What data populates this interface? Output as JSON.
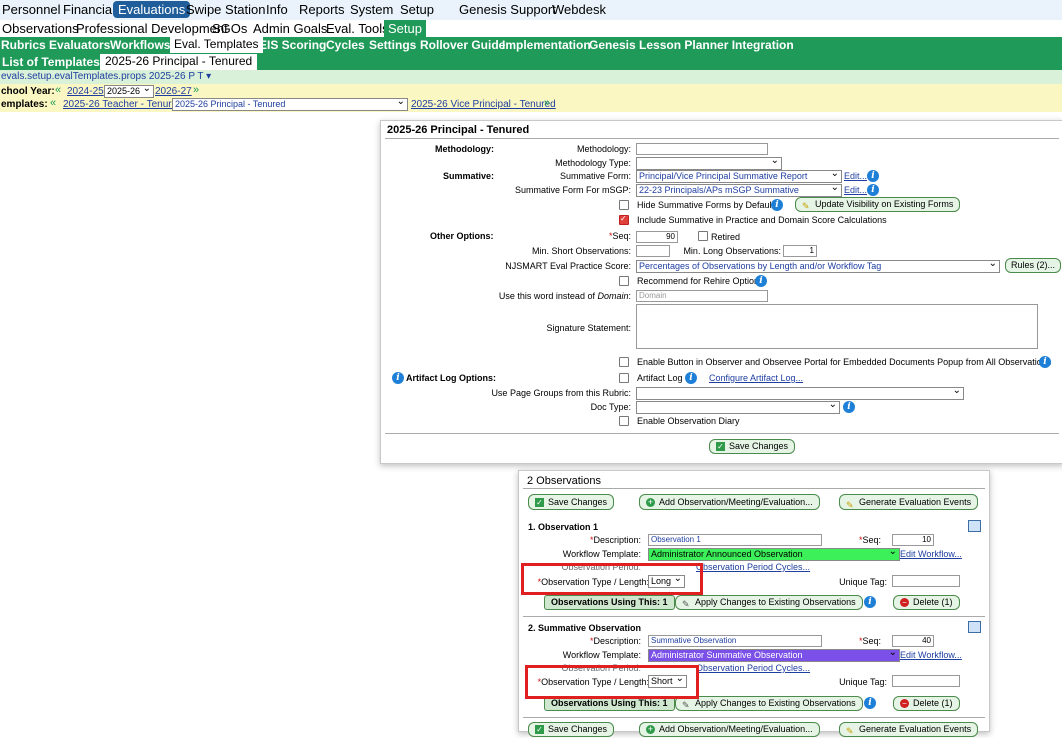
{
  "nav": {
    "main": [
      "Personnel",
      "Financial",
      "Evaluations",
      "Swipe Station",
      "Info",
      "Reports",
      "System",
      "Setup",
      "Genesis Support",
      "Webdesk"
    ],
    "sub": [
      "Observations",
      "Professional Development",
      "SGOs",
      "Admin Goals",
      "Eval. Tools",
      "Setup"
    ],
    "setup": [
      "Rubrics",
      "Evaluators",
      "Workflows",
      "Eval. Templates",
      "EIS Scoring",
      "Cycles",
      "Settings",
      "Rollover Guide",
      "Implementation",
      "Genesis Lesson Planner Integration"
    ],
    "list_label": "List of Templates",
    "current_template": "2025-26 Principal - Tenured"
  },
  "path": "evals.setup.evalTemplates.props 2025-26 P T",
  "year": {
    "label": "chool Year:",
    "prev": "2024-25",
    "current": "2025-26",
    "next": "2026-27",
    "templates_label": "emplates:",
    "prev_tpl": "2025-26 Teacher - Tenured",
    "current_tpl": "2025-26 Principal - Tenured",
    "next_tpl": "2025-26 Vice Principal - Tenured"
  },
  "template": {
    "title": "2025-26 Principal - Tenured",
    "methodology_section": "Methodology:",
    "methodology_label": "Methodology:",
    "methodology_type_label": "Methodology Type:",
    "summative_section": "Summative:",
    "summative_form_label": "Summative Form:",
    "summative_form_value": "Principal/Vice Principal Summative Report",
    "edit_link": "Edit...",
    "summative_msgp_label": "Summative Form For mSGP:",
    "summative_msgp_value": "22-23 Principals/APs mSGP Summative",
    "hide_summative": "Hide Summative Forms by Default",
    "update_visibility": "Update Visibility on Existing Forms",
    "include_summative": "Include Summative in Practice and Domain Score Calculations",
    "other_section": "Other Options:",
    "seq_label": "Seq:",
    "seq_value": "90",
    "retired": "Retired",
    "min_short_label": "Min. Short Observations:",
    "min_long_label": "Min. Long Observations:",
    "min_long_value": "1",
    "njsmart_label": "NJSMART Eval Practice Score:",
    "njsmart_value": "Percentages of Observations by Length and/or Workflow Tag",
    "rules_btn": "Rules (2)...",
    "rehire": "Recommend for Rehire Option",
    "use_word_label": "Use this word instead of",
    "use_word_em": "Domain",
    "use_word_placeholder": "Domain",
    "signature_label": "Signature Statement:",
    "enable_button": "Enable Button in Observer and Observee Portal for Embedded Documents Popup from All Observations",
    "artifact_section": "Artifact Log Options:",
    "artifact_log": "Artifact Log",
    "configure_artifact": "Configure Artifact Log...",
    "page_groups_label": "Use Page Groups from this Rubric:",
    "doc_type_label": "Doc Type:",
    "enable_diary": "Enable Observation Diary",
    "save_changes": "Save Changes"
  },
  "observations": {
    "title": "2 Observations",
    "save_changes": "Save Changes",
    "add_btn": "Add Observation/Meeting/Evaluation...",
    "generate_btn": "Generate Evaluation Events",
    "description_label": "Description:",
    "seq_label": "Seq:",
    "workflow_label": "Workflow Template:",
    "edit_workflow": "Edit Workflow...",
    "period_label": "Observation Period:",
    "period_cycles": "Observation Period Cycles...",
    "type_label": "Observation Type / Length:",
    "unique_tag_label": "Unique Tag:",
    "apply_btn": "Apply Changes to Existing Observations",
    "items": [
      {
        "heading": "1. Observation 1",
        "description": "Observation 1",
        "seq": "10",
        "workflow": "Administrator Announced Observation",
        "workflow_color": "#3cf05a",
        "type": "Long",
        "using": "Observations Using This: 1",
        "delete": "Delete (1)"
      },
      {
        "heading": "2. Summative Observation",
        "description": "Summative Observation",
        "seq": "40",
        "workflow": "Administrator Summative Observation",
        "workflow_color": "#7a50e8",
        "type": "Short",
        "using": "Observations Using This: 1",
        "delete": "Delete (1)"
      }
    ]
  },
  "colors": {
    "green": "#1f9a59",
    "blue_active": "#1f5e9a",
    "highlight": "#e02020"
  }
}
